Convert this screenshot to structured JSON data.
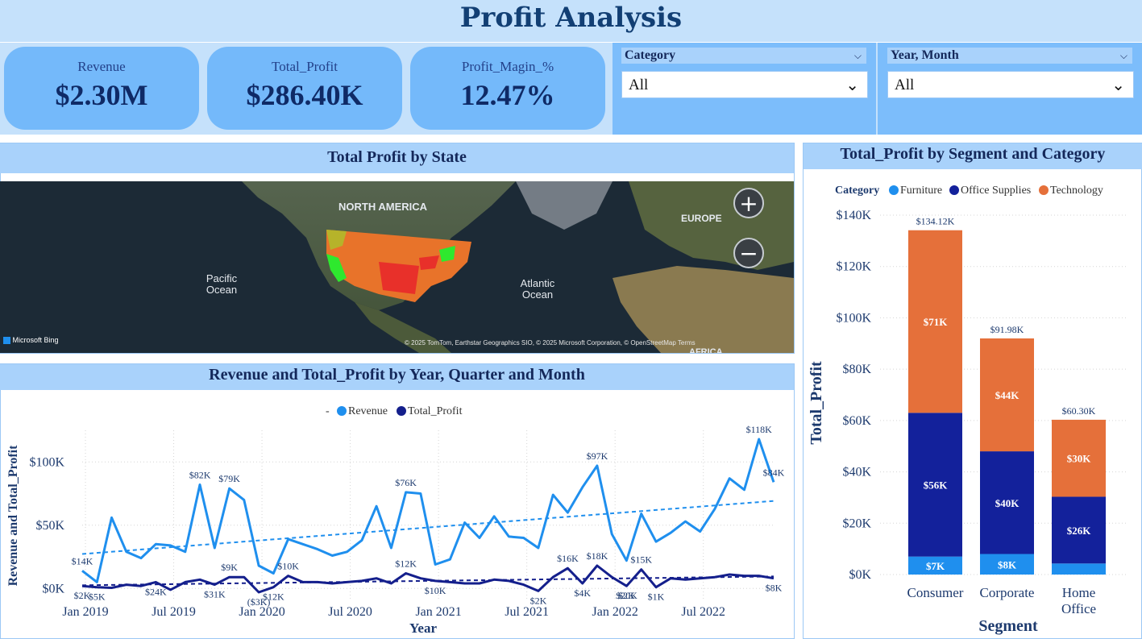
{
  "header": {
    "title": "Profit Analysis"
  },
  "kpis": [
    {
      "label": "Revenue",
      "value": "$2.30M"
    },
    {
      "label": "Total_Profit",
      "value": "$286.40K"
    },
    {
      "label": "Profit_Magin_%",
      "value": "12.47%"
    }
  ],
  "slicers": [
    {
      "title": "Category",
      "value": "All"
    },
    {
      "title": "Year, Month",
      "value": "All"
    }
  ],
  "map": {
    "title": "Total Profit by State",
    "labels": {
      "north_america": "NORTH AMERICA",
      "europe": "EUROPE",
      "pacific": "Pacific Ocean",
      "atlantic": "Atlantic Ocean",
      "africa": "AFRICA"
    },
    "brand": "Microsoft Bing",
    "attribution": "© 2025 TomTom, Earthstar Geographics SIO, © 2025 Microsoft Corporation, © OpenStreetMap  Terms",
    "zoom_in": "+",
    "zoom_out": "−",
    "colors": {
      "high": "#2ee82e",
      "mid": "#e8732a",
      "low": "#e8302a",
      "ocean": "#1c2a36"
    }
  },
  "line_chart": {
    "title": "Revenue and Total_Profit by Year, Quarter and Month"
  },
  "bar_chart": {
    "title": "Total_Profit by Segment and Category"
  },
  "chart_data": [
    {
      "type": "line",
      "title": "Revenue and Total_Profit by Year, Quarter and Month",
      "xlabel": "Year",
      "ylabel": "Revenue and Total_Profit",
      "legend_prefix": "-",
      "legend_position": "top-center",
      "x": [
        "2019-01",
        "2019-02",
        "2019-03",
        "2019-04",
        "2019-05",
        "2019-06",
        "2019-07",
        "2019-08",
        "2019-09",
        "2019-10",
        "2019-11",
        "2019-12",
        "2020-01",
        "2020-02",
        "2020-03",
        "2020-04",
        "2020-05",
        "2020-06",
        "2020-07",
        "2020-08",
        "2020-09",
        "2020-10",
        "2020-11",
        "2020-12",
        "2021-01",
        "2021-02",
        "2021-03",
        "2021-04",
        "2021-05",
        "2021-06",
        "2021-07",
        "2021-08",
        "2021-09",
        "2021-10",
        "2021-11",
        "2021-12",
        "2022-01",
        "2022-02",
        "2022-03",
        "2022-04",
        "2022-05",
        "2022-06",
        "2022-07",
        "2022-08",
        "2022-09",
        "2022-10",
        "2022-11",
        "2022-12"
      ],
      "x_ticks": [
        "Jan 2019",
        "Jul 2019",
        "Jan 2020",
        "Jul 2020",
        "Jan 2021",
        "Jul 2021",
        "Jan 2022",
        "Jul 2022"
      ],
      "x_tick_index": [
        0,
        6,
        12,
        18,
        24,
        30,
        36,
        42
      ],
      "y_ticks": [
        "$0K",
        "$50K",
        "$100K"
      ],
      "y_tick_values": [
        0,
        50000,
        100000
      ],
      "ylim": [
        -10000,
        125000
      ],
      "grid": true,
      "series": [
        {
          "name": "Revenue",
          "color": "#1f8fee",
          "trend": true,
          "values": [
            14000,
            5000,
            56000,
            29000,
            24000,
            35000,
            34000,
            29000,
            82000,
            32000,
            79000,
            70000,
            18000,
            12000,
            39000,
            35000,
            31000,
            26000,
            29000,
            38000,
            65000,
            32000,
            76000,
            75000,
            19000,
            23000,
            52000,
            40000,
            57000,
            41000,
            40000,
            32000,
            74000,
            60000,
            80000,
            97000,
            43000,
            22000,
            59000,
            37000,
            44000,
            53000,
            45000,
            63000,
            87000,
            78000,
            118000,
            84000
          ]
        },
        {
          "name": "Total_Profit",
          "color": "#141f8c",
          "trend": true,
          "values": [
            2000,
            1000,
            500,
            3000,
            2000,
            5000,
            -1000,
            5000,
            7000,
            3000,
            9000,
            9000,
            -3000,
            1000,
            10000,
            5000,
            5000,
            4000,
            5000,
            6000,
            8000,
            4000,
            12000,
            8000,
            6000,
            5000,
            4000,
            4000,
            7000,
            6000,
            3000,
            -2000,
            9000,
            16000,
            4000,
            18000,
            9000,
            2000,
            15000,
            1000,
            8000,
            7000,
            8000,
            9000,
            11000,
            10000,
            10000,
            8000
          ]
        }
      ],
      "data_labels": [
        {
          "series": 0,
          "index": 0,
          "text": "$14K"
        },
        {
          "series": 1,
          "index": 0,
          "text": "$2K"
        },
        {
          "series": 1,
          "index": 1,
          "text": "$5K"
        },
        {
          "series": 1,
          "index": 5,
          "text": "$24K"
        },
        {
          "series": 0,
          "index": 8,
          "text": "$82K"
        },
        {
          "series": 0,
          "index": 10,
          "text": "$79K"
        },
        {
          "series": 1,
          "index": 9,
          "text": "$31K"
        },
        {
          "series": 1,
          "index": 10,
          "text": "$9K"
        },
        {
          "series": 1,
          "index": 12,
          "text": "($3K)"
        },
        {
          "series": 1,
          "index": 13,
          "text": "$12K"
        },
        {
          "series": 1,
          "index": 14,
          "text": "$10K"
        },
        {
          "series": 0,
          "index": 22,
          "text": "$76K"
        },
        {
          "series": 1,
          "index": 22,
          "text": "$12K"
        },
        {
          "series": 1,
          "index": 24,
          "text": "$10K"
        },
        {
          "series": 1,
          "index": 31,
          "text": "$2K"
        },
        {
          "series": 1,
          "index": 33,
          "text": "$16K"
        },
        {
          "series": 1,
          "index": 34,
          "text": "$4K"
        },
        {
          "series": 0,
          "index": 35,
          "text": "$97K"
        },
        {
          "series": 1,
          "index": 35,
          "text": "$18K"
        },
        {
          "series": 1,
          "index": 37,
          "text": "$2K"
        },
        {
          "series": 1,
          "index": 37,
          "text": "$20K"
        },
        {
          "series": 1,
          "index": 38,
          "text": "$15K"
        },
        {
          "series": 1,
          "index": 39,
          "text": "$1K"
        },
        {
          "series": 0,
          "index": 46,
          "text": "$118K"
        },
        {
          "series": 0,
          "index": 47,
          "text": "$84K"
        },
        {
          "series": 1,
          "index": 47,
          "text": "$8K"
        }
      ]
    },
    {
      "type": "bar",
      "stacked": true,
      "title": "Total_Profit by Segment and Category",
      "xlabel": "Segment",
      "ylabel": "Total_Profit",
      "legend_title": "Category",
      "legend_position": "top-left",
      "categories": [
        "Consumer",
        "Corporate",
        "Home Office"
      ],
      "ylim": [
        0,
        140000
      ],
      "y_ticks": [
        "$0K",
        "$20K",
        "$40K",
        "$60K",
        "$80K",
        "$100K",
        "$120K",
        "$140K"
      ],
      "y_tick_values": [
        0,
        20000,
        40000,
        60000,
        80000,
        100000,
        120000,
        140000
      ],
      "grid": true,
      "series": [
        {
          "name": "Furniture",
          "color": "#1f8fee",
          "values": [
            7000,
            8000,
            4300
          ],
          "labels": [
            "$7K",
            "$8K",
            ""
          ]
        },
        {
          "name": "Office Supplies",
          "color": "#13219b",
          "values": [
            56000,
            40000,
            26000
          ],
          "labels": [
            "$56K",
            "$40K",
            "$26K"
          ]
        },
        {
          "name": "Technology",
          "color": "#e5703a",
          "values": [
            71120,
            43980,
            30000
          ],
          "labels": [
            "$71K",
            "$44K",
            "$30K"
          ]
        }
      ],
      "totals": [
        "$134.12K",
        "$91.98K",
        "$60.30K"
      ]
    }
  ]
}
